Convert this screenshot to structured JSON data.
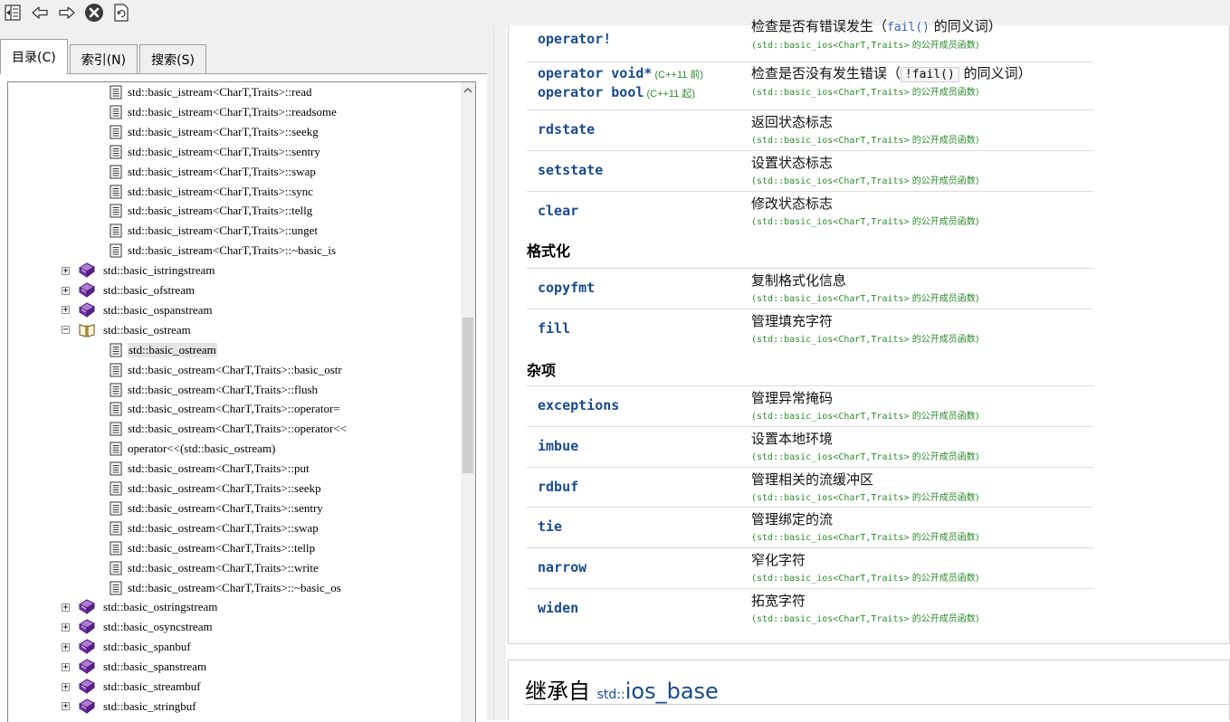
{
  "toolbar": {
    "buttons": [
      "hide-pane-icon",
      "back-arrow-icon",
      "forward-arrow-icon",
      "stop-icon",
      "refresh-icon"
    ]
  },
  "left_pane": {
    "tabs": [
      {
        "label": "目录(C)",
        "active": true
      },
      {
        "label": "索引(N)",
        "active": false
      },
      {
        "label": "搜索(S)",
        "active": false
      }
    ],
    "tree": [
      {
        "kind": "doc",
        "indent": 1,
        "label": "std::basic_istream<CharT,Traits>::read"
      },
      {
        "kind": "doc",
        "indent": 1,
        "label": "std::basic_istream<CharT,Traits>::readsome"
      },
      {
        "kind": "doc",
        "indent": 1,
        "label": "std::basic_istream<CharT,Traits>::seekg"
      },
      {
        "kind": "doc",
        "indent": 1,
        "label": "std::basic_istream<CharT,Traits>::sentry"
      },
      {
        "kind": "doc",
        "indent": 1,
        "label": "std::basic_istream<CharT,Traits>::swap"
      },
      {
        "kind": "doc",
        "indent": 1,
        "label": "std::basic_istream<CharT,Traits>::sync"
      },
      {
        "kind": "doc",
        "indent": 1,
        "label": "std::basic_istream<CharT,Traits>::tellg"
      },
      {
        "kind": "doc",
        "indent": 1,
        "label": "std::basic_istream<CharT,Traits>::unget"
      },
      {
        "kind": "doc",
        "indent": 1,
        "label": "std::basic_istream<CharT,Traits>::~basic_is"
      },
      {
        "kind": "book",
        "indent": 0,
        "expander": "+",
        "label": "std::basic_istringstream"
      },
      {
        "kind": "book",
        "indent": 0,
        "expander": "+",
        "label": "std::basic_ofstream"
      },
      {
        "kind": "book",
        "indent": 0,
        "expander": "+",
        "label": "std::basic_ospanstream"
      },
      {
        "kind": "openbook",
        "indent": 0,
        "expander": "−",
        "label": "std::basic_ostream"
      },
      {
        "kind": "doc",
        "indent": 1,
        "label": "std::basic_ostream",
        "selected": true
      },
      {
        "kind": "doc",
        "indent": 1,
        "label": "std::basic_ostream<CharT,Traits>::basic_ostr"
      },
      {
        "kind": "doc",
        "indent": 1,
        "label": "std::basic_ostream<CharT,Traits>::flush"
      },
      {
        "kind": "doc",
        "indent": 1,
        "label": "std::basic_ostream<CharT,Traits>::operator="
      },
      {
        "kind": "doc",
        "indent": 1,
        "label": "std::basic_ostream<CharT,Traits>::operator<<"
      },
      {
        "kind": "doc",
        "indent": 1,
        "label": "operator<<(std::basic_ostream)"
      },
      {
        "kind": "doc",
        "indent": 1,
        "label": "std::basic_ostream<CharT,Traits>::put"
      },
      {
        "kind": "doc",
        "indent": 1,
        "label": "std::basic_ostream<CharT,Traits>::seekp"
      },
      {
        "kind": "doc",
        "indent": 1,
        "label": "std::basic_ostream<CharT,Traits>::sentry"
      },
      {
        "kind": "doc",
        "indent": 1,
        "label": "std::basic_ostream<CharT,Traits>::swap"
      },
      {
        "kind": "doc",
        "indent": 1,
        "label": "std::basic_ostream<CharT,Traits>::tellp"
      },
      {
        "kind": "doc",
        "indent": 1,
        "label": "std::basic_ostream<CharT,Traits>::write"
      },
      {
        "kind": "doc",
        "indent": 1,
        "label": "std::basic_ostream<CharT,Traits>::~basic_os"
      },
      {
        "kind": "book",
        "indent": 0,
        "expander": "+",
        "label": "std::basic_ostringstream"
      },
      {
        "kind": "book",
        "indent": 0,
        "expander": "+",
        "label": "std::basic_osyncstream"
      },
      {
        "kind": "book",
        "indent": 0,
        "expander": "+",
        "label": "std::basic_spanbuf"
      },
      {
        "kind": "book",
        "indent": 0,
        "expander": "+",
        "label": "std::basic_spanstream"
      },
      {
        "kind": "book",
        "indent": 0,
        "expander": "+",
        "label": "std::basic_streambuf"
      },
      {
        "kind": "book",
        "indent": 0,
        "expander": "+",
        "label": "std::basic_stringbuf"
      }
    ]
  },
  "content": {
    "member_sub": "(std::basic_ios<CharT,Traits>",
    "member_sub_zh": " 的公开成员函数)",
    "rows_top": [
      {
        "name": "operator!",
        "desc_pre": "检查是否有错误发生（",
        "desc_code": "fail()",
        "desc_post": " 的同义词）"
      },
      {
        "name": "operator void*",
        "name_ver": " (C++11 前)",
        "name2": "operator bool",
        "name2_ver": "  (C++11 起)",
        "desc_pre": "检查是否没有发生错误（",
        "desc_code": "!fail()",
        "desc_post": " 的同义词）"
      },
      {
        "name": "rdstate",
        "desc": "返回状态标志"
      },
      {
        "name": "setstate",
        "desc": "设置状态标志"
      },
      {
        "name": "clear",
        "desc": "修改状态标志"
      }
    ],
    "section_format": "格式化",
    "rows_format": [
      {
        "name": "copyfmt",
        "desc": "复制格式化信息"
      },
      {
        "name": "fill",
        "desc": "管理填充字符"
      }
    ],
    "section_misc": "杂项",
    "rows_misc": [
      {
        "name": "exceptions",
        "desc": "管理异常掩码"
      },
      {
        "name": "imbue",
        "desc": "设置本地环境"
      },
      {
        "name": "rdbuf",
        "desc": "管理相关的流缓冲区"
      },
      {
        "name": "tie",
        "desc": "管理绑定的流"
      },
      {
        "name": "narrow",
        "desc": "窄化字符"
      },
      {
        "name": "widen",
        "desc": "拓宽字符"
      }
    ],
    "inherit_title": "继承自 ",
    "inherit_ns": "std::",
    "inherit_class": "ios_base"
  }
}
